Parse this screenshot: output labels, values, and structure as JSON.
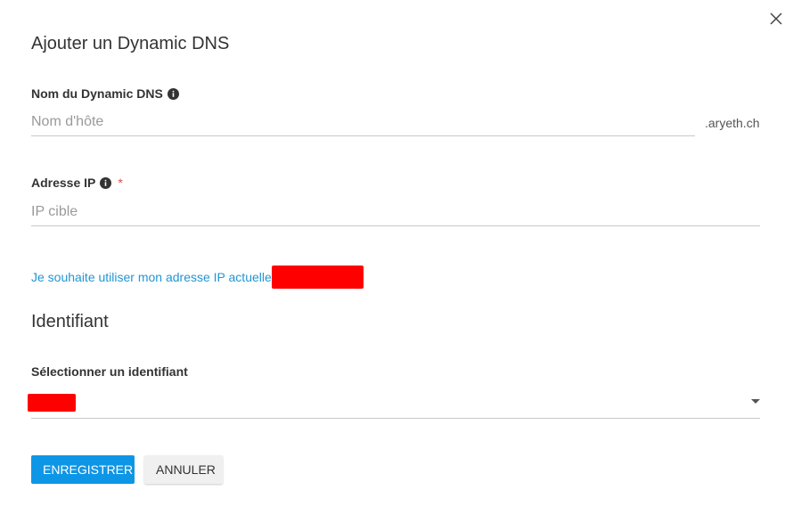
{
  "dialog": {
    "title": "Ajouter un Dynamic DNS"
  },
  "hostname_field": {
    "label": "Nom du Dynamic DNS",
    "placeholder": "Nom d'hôte",
    "value": "",
    "suffix": ".aryeth.ch"
  },
  "ip_field": {
    "label": "Adresse IP",
    "required_mark": "*",
    "placeholder": "IP cible",
    "value": ""
  },
  "use_current_ip_link": {
    "text": "Je souhaite utiliser mon adresse IP actuelle"
  },
  "identifier_section": {
    "title": "Identifiant",
    "select_label": "Sélectionner un identifiant"
  },
  "buttons": {
    "save": "ENREGISTRER",
    "cancel": "ANNULER"
  },
  "colors": {
    "accent": "#0e96e6",
    "link": "#2196d3",
    "redaction": "#ff0000",
    "required": "#e04a4a"
  },
  "icons": {
    "close": "close-icon",
    "info": "info-icon",
    "dropdown": "caret-down-icon"
  }
}
